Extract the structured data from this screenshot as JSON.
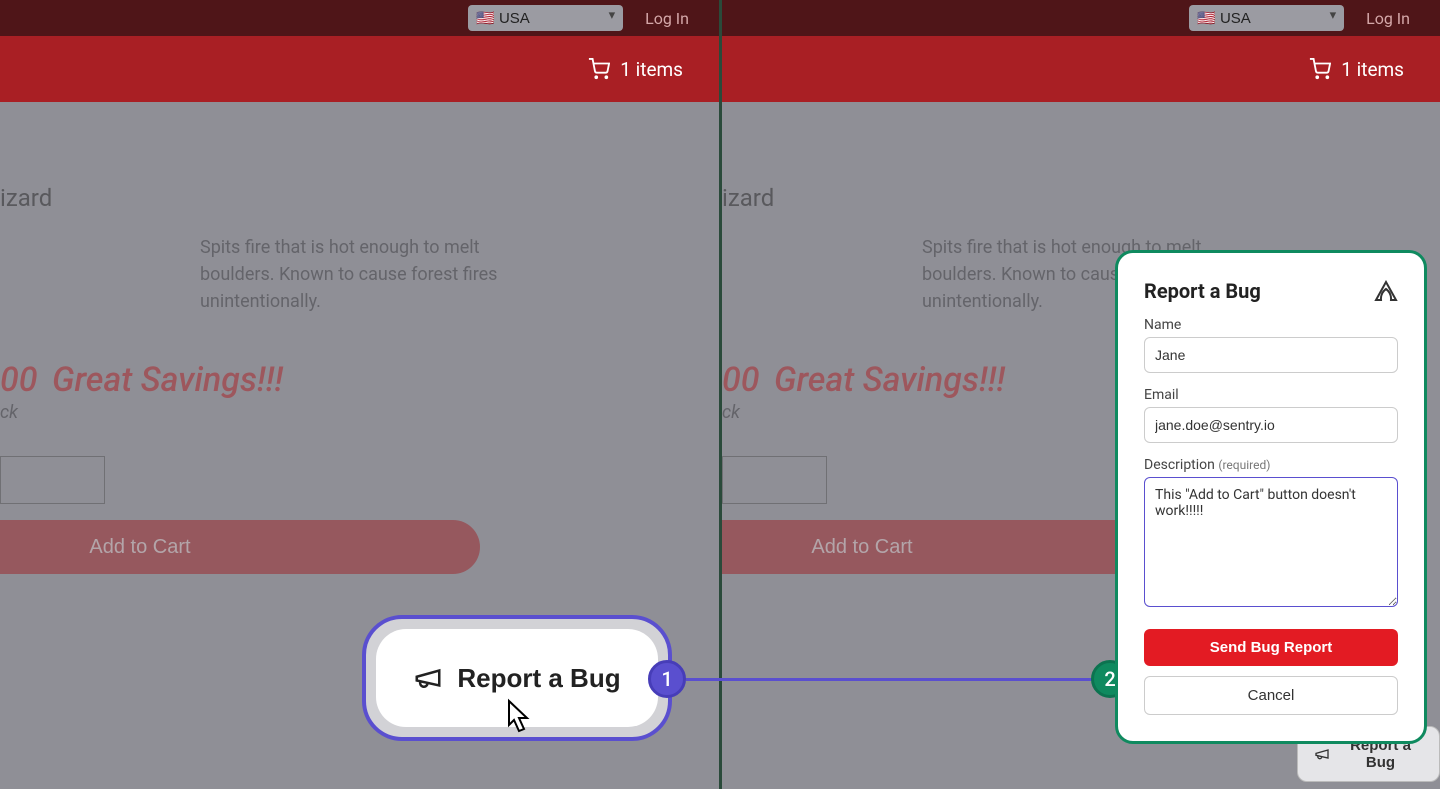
{
  "topbar": {
    "country": "🇺🇸 USA",
    "login": "Log In"
  },
  "cart": {
    "items_label": "1 items"
  },
  "product": {
    "title_fragment": "izard",
    "description": "Spits fire that is hot enough to melt boulders. Known to cause forest fires unintentionally.",
    "price_fragment": "00",
    "savings": "Great Savings!!!",
    "stock_fragment": "ck",
    "add_to_cart": "Add to Cart"
  },
  "report_button": {
    "label": "Report a Bug"
  },
  "report_small": {
    "label": "Report a Bug"
  },
  "modal": {
    "title": "Report a Bug",
    "name_label": "Name",
    "name_value": "Jane",
    "email_label": "Email",
    "email_value": "jane.doe@sentry.io",
    "desc_label": "Description",
    "desc_required": "(required)",
    "desc_value": "This \"Add to Cart\" button doesn't work!!!!!",
    "send": "Send Bug Report",
    "cancel": "Cancel"
  },
  "badges": {
    "one": "1",
    "two": "2"
  }
}
